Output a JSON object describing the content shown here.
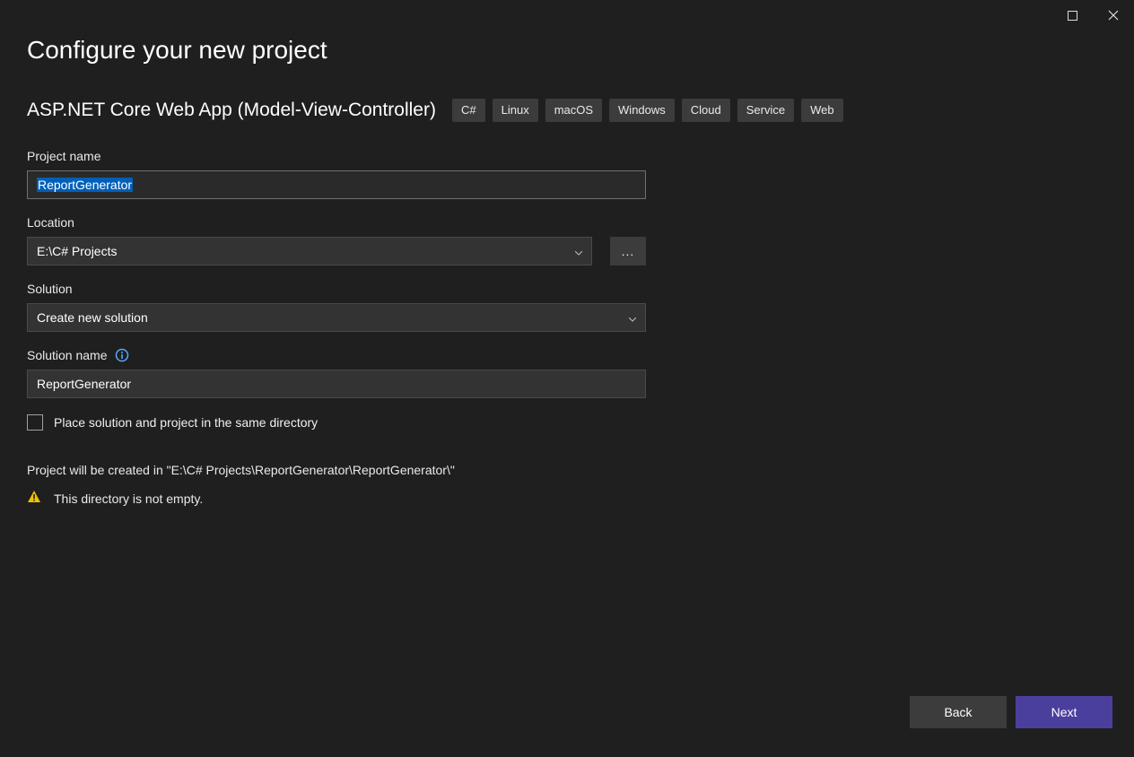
{
  "page_title": "Configure your new project",
  "template": {
    "name": "ASP.NET Core Web App (Model-View-Controller)",
    "tags": [
      "C#",
      "Linux",
      "macOS",
      "Windows",
      "Cloud",
      "Service",
      "Web"
    ]
  },
  "fields": {
    "project_name": {
      "label": "Project name",
      "value": "ReportGenerator"
    },
    "location": {
      "label": "Location",
      "value": "E:\\C# Projects",
      "browse": "..."
    },
    "solution": {
      "label": "Solution",
      "value": "Create new solution"
    },
    "solution_name": {
      "label": "Solution name",
      "value": "ReportGenerator"
    },
    "same_directory_checkbox_label": "Place solution and project in the same directory"
  },
  "info_path": "Project will be created in \"E:\\C# Projects\\ReportGenerator\\ReportGenerator\\\"",
  "warning": "This directory is not empty.",
  "buttons": {
    "back": "Back",
    "next": "Next"
  }
}
